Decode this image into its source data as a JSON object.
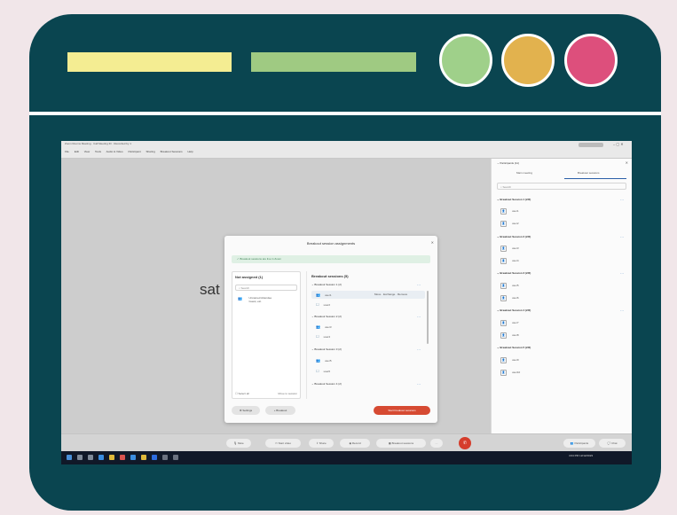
{
  "colors": {
    "background": "#f1e6e9",
    "frame": "#0a4550",
    "bar_yellow": "#f4ed92",
    "bar_green": "#9fca82",
    "dot_green": "#9fd08a",
    "dot_yellow": "#e2b24e",
    "dot_pink": "#dd4f7c",
    "accent_red": "#d53d2c"
  },
  "window": {
    "title": "Zoom Rooms Meeting · Call Meeting ID · Recorded by 1",
    "menus": [
      "File",
      "Edit",
      "View",
      "Tools",
      "Audio & Video",
      "Participant",
      "Sharing",
      "Breakout Sessions",
      "Help"
    ],
    "close_icon": "close-icon"
  },
  "stage": {
    "shared_text": "sat"
  },
  "dialog": {
    "title": "Breakout session assignments",
    "banner": "Breakout sessions are live in Zoom",
    "not_assigned_title": "Not assigned (1)",
    "search_placeholder": "Search",
    "unassigned_person": "Unnamed Attendee",
    "unassigned_sub": "Guest, etc.",
    "select_all": "Select all",
    "move_hint": "Move to session",
    "breakout_title": "Breakout sessions (5)",
    "rooms": [
      {
        "name": "Breakout Session 1 (2)",
        "members": [
          "user1",
          "user2"
        ],
        "options": "Move · Exchange · Remove"
      },
      {
        "name": "Breakout Session 2 (2)",
        "members": [
          "user3",
          "user4"
        ]
      },
      {
        "name": "Breakout Session 3 (2)",
        "members": [
          "user5",
          "user6"
        ]
      },
      {
        "name": "Breakout Session 4 (2)",
        "members": []
      }
    ],
    "settings_label": "Settings",
    "add_label": "+ Breakout",
    "start_label": "Start breakout sessions"
  },
  "panel": {
    "title": "Participants (11)",
    "tabs": [
      "Main meeting",
      "Breakout sessions"
    ],
    "search_placeholder": "Search",
    "rooms": [
      {
        "name": "Breakout Session 1 (2/2)",
        "members": [
          "user1",
          "user2"
        ]
      },
      {
        "name": "Breakout Session 2 (2/2)",
        "members": [
          "user3",
          "user4"
        ]
      },
      {
        "name": "Breakout Session 3 (2/2)",
        "members": [
          "user5",
          "user6"
        ]
      },
      {
        "name": "Breakout Session 4 (2/2)",
        "members": [
          "user7",
          "user8"
        ]
      },
      {
        "name": "Breakout Session 5 (2/2)",
        "members": [
          "user9",
          "user10"
        ]
      }
    ]
  },
  "controls": {
    "mic": "Mute",
    "camera": "Start video",
    "share": "Share",
    "record": "Record",
    "breakout": "Breakout sessions",
    "more": "···",
    "participants": "Participants",
    "chat": "Chat"
  },
  "taskbar": {
    "time": "4:04 PM",
    "date": "12/12/2023"
  }
}
